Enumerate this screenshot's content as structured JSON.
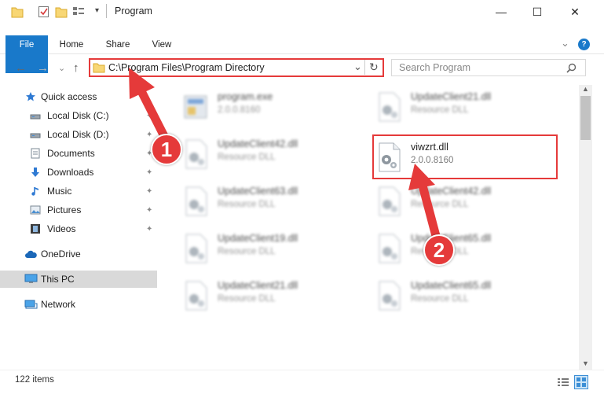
{
  "window": {
    "title": "Program",
    "min_glyph": "—",
    "max_glyph": "☐",
    "close_glyph": "✕"
  },
  "ribbon": {
    "tabs": [
      "File",
      "Home",
      "Share",
      "View"
    ],
    "expand_glyph": "⌄",
    "help_glyph": "?"
  },
  "address": {
    "path": "C:\\Program Files\\Program Directory",
    "dropdown_glyph": "⌄",
    "refresh_glyph": "↻"
  },
  "search": {
    "placeholder": "Search Program"
  },
  "nav": {
    "back": "←",
    "forward": "→",
    "history": "⌄",
    "up": "↑"
  },
  "sidebar": {
    "items": [
      {
        "label": "Quick access",
        "icon": "star-icon"
      },
      {
        "label": "Local Disk (C:)",
        "icon": "drive-icon"
      },
      {
        "label": "Local Disk (D:)",
        "icon": "drive-icon"
      },
      {
        "label": "Documents",
        "icon": "documents-icon"
      },
      {
        "label": "Downloads",
        "icon": "download-icon"
      },
      {
        "label": "Music",
        "icon": "music-icon"
      },
      {
        "label": "Pictures",
        "icon": "pictures-icon"
      },
      {
        "label": "Videos",
        "icon": "videos-icon"
      },
      {
        "label": "OneDrive",
        "icon": "cloud-icon"
      },
      {
        "label": "This PC",
        "icon": "computer-icon"
      },
      {
        "label": "Network",
        "icon": "network-icon"
      }
    ],
    "pin_glyph": "📌"
  },
  "files": {
    "col1": [
      {
        "name": "program.exe",
        "sub": "2.0.0.8160"
      },
      {
        "name": "UpdateClient42.dll",
        "sub": "Resource DLL"
      },
      {
        "name": "UpdateClient63.dll",
        "sub": "Resource DLL"
      },
      {
        "name": "UpdateClient19.dll",
        "sub": "Resource DLL"
      },
      {
        "name": "UpdateClient21.dll",
        "sub": "Resource DLL"
      }
    ],
    "col2": [
      {
        "name": "UpdateClient21.dll",
        "sub": "Resource DLL"
      },
      {
        "name": "viwzrt.dll",
        "sub": "2.0.0.8160"
      },
      {
        "name": "UpdateClient42.dll",
        "sub": "Resource DLL"
      },
      {
        "name": "UpdateClient65.dll",
        "sub": "Resource DLL"
      },
      {
        "name": "UpdateClient65.dll",
        "sub": "Resource DLL"
      }
    ]
  },
  "status": {
    "count": "122 items"
  },
  "callouts": [
    "1",
    "2"
  ],
  "colors": {
    "accent": "#1979ca",
    "highlight": "#e53a3a"
  }
}
